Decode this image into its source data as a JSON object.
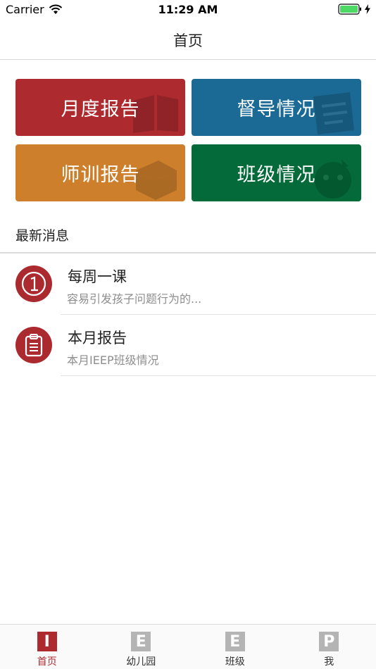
{
  "status_bar": {
    "carrier": "Carrier",
    "time": "11:29 AM",
    "battery_color": "#4cd964"
  },
  "nav": {
    "title": "首页"
  },
  "tiles": [
    {
      "label": "月度报告",
      "color": "#ad2a2f",
      "icon": "book-icon"
    },
    {
      "label": "督导情况",
      "color": "#1a6a95",
      "icon": "notepad-icon"
    },
    {
      "label": "师训报告",
      "color": "#cd7f2b",
      "icon": "box-icon"
    },
    {
      "label": "班级情况",
      "color": "#046a3a",
      "icon": "face-icon"
    }
  ],
  "news": {
    "section_title": "最新消息",
    "items": [
      {
        "title": "每周一课",
        "subtitle": "容易引发孩子问题行为的...",
        "icon": "number-one-icon"
      },
      {
        "title": "本月报告",
        "subtitle": "本月IEEP班级情况",
        "icon": "clipboard-icon"
      }
    ]
  },
  "tab_bar": {
    "accent": "#ad2a2f",
    "inactive": "#b4b4b4",
    "tabs": [
      {
        "glyph": "I",
        "label": "首页",
        "active": true
      },
      {
        "glyph": "E",
        "label": "幼儿园",
        "active": false
      },
      {
        "glyph": "E",
        "label": "班级",
        "active": false
      },
      {
        "glyph": "P",
        "label": "我",
        "active": false
      }
    ]
  }
}
